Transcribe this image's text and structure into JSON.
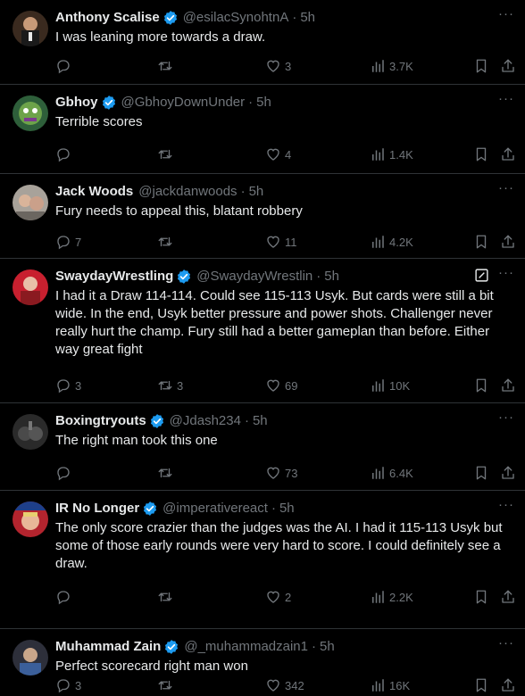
{
  "tweets": [
    {
      "name": "Anthony Scalise",
      "verified": true,
      "handle": "@esilacSynohtnA",
      "time": "5h",
      "text": "I was leaning more towards a draw.",
      "replies": "",
      "retweets": "",
      "likes": "3",
      "views": "3.7K",
      "grok": false
    },
    {
      "name": "Gbhoy",
      "verified": true,
      "handle": "@GbhoyDownUnder",
      "time": "5h",
      "text": "Terrible scores",
      "replies": "",
      "retweets": "",
      "likes": "4",
      "views": "1.4K",
      "grok": false
    },
    {
      "name": "Jack Woods",
      "verified": false,
      "handle": "@jackdanwoods",
      "time": "5h",
      "text": "Fury needs to appeal this, blatant robbery",
      "replies": "7",
      "retweets": "",
      "likes": "11",
      "views": "4.2K",
      "grok": false
    },
    {
      "name": "SwaydayWrestling",
      "verified": true,
      "handle": "@SwaydayWrestlin",
      "time": "5h",
      "text": "I had it a Draw 114-114. Could see 115-113 Usyk. But cards were still a bit\nwide. In the end, Usyk better pressure and power shots. Challenger never\nreally hurt the champ. Fury still had a better gameplan than before. Either\nway great fight",
      "replies": "3",
      "retweets": "3",
      "likes": "69",
      "views": "10K",
      "grok": true
    },
    {
      "name": "Boxingtryouts",
      "verified": true,
      "handle": "@Jdash234",
      "time": "5h",
      "text": "The right man took this one",
      "replies": "",
      "retweets": "",
      "likes": "73",
      "views": "6.4K",
      "grok": false
    },
    {
      "name": "IR No Longer",
      "verified": true,
      "handle": "@imperativereact",
      "time": "5h",
      "text": "The only score crazier than the judges was the AI. I had it 115-113 Usyk but\nsome of those early rounds were very hard to score. I could definitely see a\ndraw.",
      "replies": "",
      "retweets": "",
      "likes": "2",
      "views": "2.2K",
      "grok": false
    },
    {
      "name": "Muhammad Zain",
      "verified": true,
      "handle": "@_muhammadzain1",
      "time": "5h",
      "text": "Perfect scorecard right man won",
      "replies": "3",
      "retweets": "",
      "likes": "342",
      "views": "16K",
      "grok": false
    }
  ],
  "separator": "·",
  "colors": {
    "background": "#000000",
    "text": "#e7e9ea",
    "muted": "#71767b",
    "verified": "#1d9bf0",
    "divider": "#2f3336"
  },
  "icons": {
    "reply": "reply-icon",
    "retweet": "retweet-icon",
    "like": "heart-icon",
    "views": "views-icon",
    "bookmark": "bookmark-icon",
    "share": "share-icon",
    "more": "more-icon",
    "verified": "verified-badge-icon",
    "grok": "grok-icon"
  }
}
